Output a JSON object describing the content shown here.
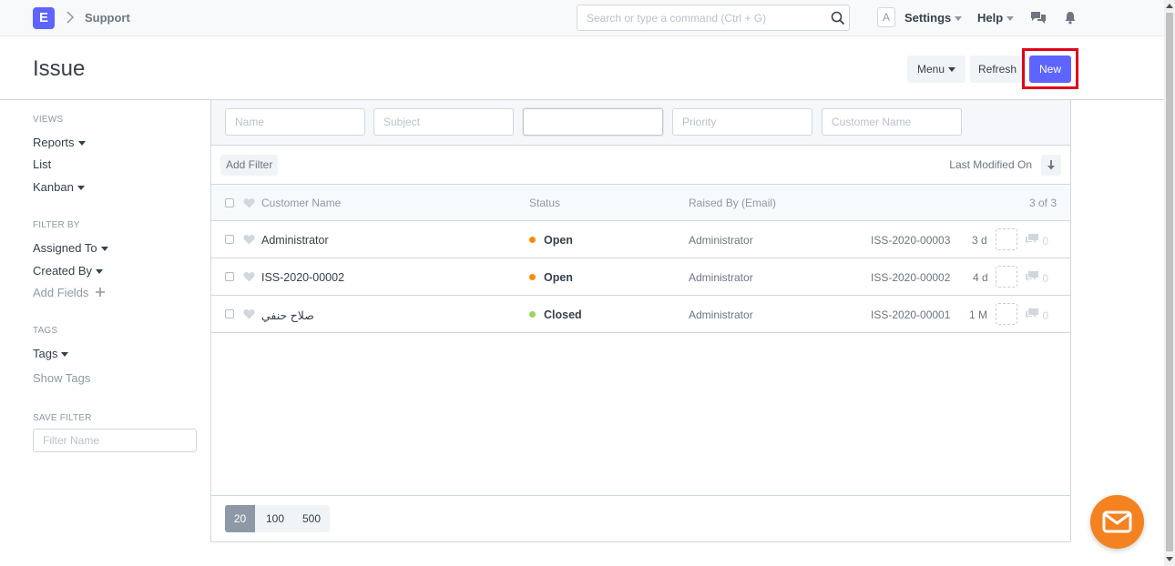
{
  "navbar": {
    "logo_letter": "E",
    "breadcrumb": "Support",
    "search_placeholder": "Search or type a command (Ctrl + G)",
    "avatar_letter": "A",
    "settings_label": "Settings",
    "help_label": "Help"
  },
  "page": {
    "title": "Issue",
    "menu_label": "Menu",
    "refresh_label": "Refresh",
    "new_label": "New"
  },
  "sidebar": {
    "views_heading": "VIEWS",
    "views": [
      "Reports",
      "List",
      "Kanban"
    ],
    "filter_by_heading": "FILTER BY",
    "assigned_to": "Assigned To",
    "created_by": "Created By",
    "add_fields": "Add Fields",
    "tags_heading": "TAGS",
    "tags": "Tags",
    "show_tags": "Show Tags",
    "save_filter_heading": "SAVE FILTER",
    "filter_name_placeholder": "Filter Name"
  },
  "filters": {
    "name_placeholder": "Name",
    "subject_placeholder": "Subject",
    "status_value": "",
    "priority_placeholder": "Priority",
    "customer_placeholder": "Customer Name",
    "add_filter": "Add Filter",
    "sort_label": "Last Modified On"
  },
  "list": {
    "columns": [
      "Customer Name",
      "Status",
      "Raised By (Email)"
    ],
    "count": "3 of 3",
    "rows": [
      {
        "name": "Administrator",
        "status": "Open",
        "status_color": "#ff8a00",
        "raised_by": "Administrator",
        "id": "ISS-2020-00003",
        "ago": "3 d",
        "comments": "0"
      },
      {
        "name": "ISS-2020-00002",
        "status": "Open",
        "status_color": "#ff8a00",
        "raised_by": "Administrator",
        "id": "ISS-2020-00002",
        "ago": "4 d",
        "comments": "0"
      },
      {
        "name": "صلاح حنفي",
        "status": "Closed",
        "status_color": "#98d85b",
        "raised_by": "Administrator",
        "id": "ISS-2020-00001",
        "ago": "1 M",
        "comments": "0"
      }
    ]
  },
  "paging": {
    "sizes": [
      "20",
      "100",
      "500"
    ]
  },
  "colors": {
    "primary": "#5e64ff",
    "fab": "#f58220",
    "highlight": "#e0001a"
  },
  "icons": [
    "search-icon",
    "chat-icon",
    "bell-icon",
    "heart-icon",
    "sort-icon",
    "comment-icon",
    "mail-icon",
    "plus-icon"
  ]
}
